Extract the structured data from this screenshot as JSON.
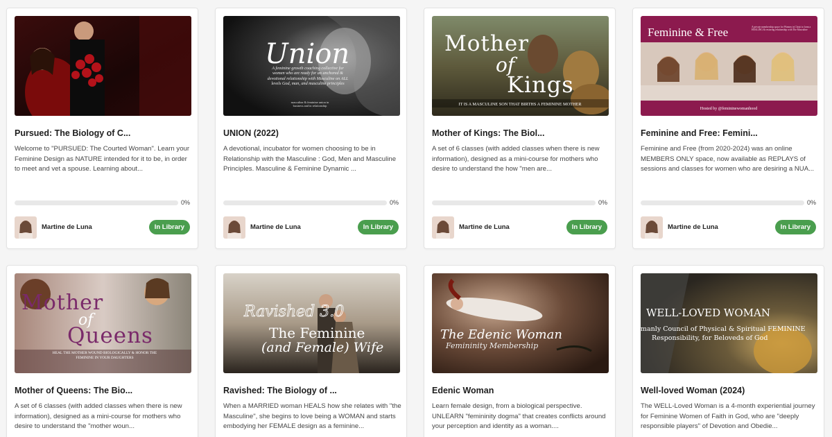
{
  "colors": {
    "accent_green": "#4a9e4e",
    "progress_track": "#e8e8e8"
  },
  "courses": [
    {
      "title": "Pursued: The Biology of C...",
      "description": "Welcome to \"PURSUED: The Courted Woman\". Learn your Feminine Design as NATURE intended for it to be, in order to meet and vet a spouse. Learning about...",
      "progress_percent": 0,
      "progress_label": "0%",
      "author": "Martine de Luna",
      "library_label": "In Library",
      "image": {
        "icon": "couple-roses-photo",
        "overlay_title": "",
        "overlay_subtitle": ""
      }
    },
    {
      "title": "UNION (2022)",
      "description": "A devotional, incubator for women choosing to be in Relationship with the Masculine : God, Men and Masculine Principles. Masculine & Feminine Dynamic ...",
      "progress_percent": 0,
      "progress_label": "0%",
      "author": "Martine de Luna",
      "library_label": "In Library",
      "image": {
        "icon": "embrace-photo",
        "overlay_title": "Union",
        "overlay_subtitle": "A feminine growth coaching collective for women who are ready for an anchored & devotional relationship with Masculine on ALL levels God, man, and masculine principles",
        "overlay_footer": "masculine & feminine union in business and in relationship"
      }
    },
    {
      "title": "Mother of Kings: The Biol...",
      "description": "A set of 6 classes (with added classes when there is new information), designed as a mini-course for mothers who desire to understand the how \"men are...",
      "progress_percent": 0,
      "progress_label": "0%",
      "author": "Martine de Luna",
      "library_label": "In Library",
      "image": {
        "icon": "mother-child-lions-photo",
        "overlay_title": "Mother",
        "overlay_script": "of",
        "overlay_title2": "Kings",
        "overlay_footer": "IT IS A MASCULINE SON THAT BIRTHS A FEMININE MOTHER"
      }
    },
    {
      "title": "Feminine and Free: Femini...",
      "description": "Feminine and Free (from 2020-2024) was an online MEMBERS ONLY space, now available as REPLAYS of sessions and classes for women who are desiring a NUA...",
      "progress_percent": 0,
      "progress_label": "0%",
      "author": "Martine de Luna",
      "library_label": "In Library",
      "image": {
        "icon": "women-group-photo",
        "overlay_title": "Feminine & Free",
        "overlay_subtitle": "A private membership space for Women in Christ to form a HEALING & restoring relationship with The Masculine",
        "overlay_footer": "Hosted by @femininewomanhood"
      }
    },
    {
      "title": "Mother of Queens: The Bio...",
      "description": "A set of 6 classes (with added classes when there is new information), designed as a mini-course for mothers who desire to understand the \"mother woun...",
      "image": {
        "icon": "mothers-daughters-photo",
        "overlay_title": "Mother",
        "overlay_script": "of",
        "overlay_title2": "Queens",
        "overlay_footer": "HEAL THE MOTHER WOUND BIOLOGICALLY & HONOR THE FEMININE IN YOUR DAUGHTERS"
      }
    },
    {
      "title": "Ravished: The Biology of ...",
      "description": "When a MARRIED woman HEALS how she relates with \"the Masculine\", she begins to love being a WOMAN and starts embodying her FEMALE design as a feminine...",
      "image": {
        "icon": "couple-sunset-photo",
        "overlay_script": "Ravished 3.0",
        "overlay_title": "The Feminine",
        "overlay_title2": "(and Female) Wife"
      }
    },
    {
      "title": "Edenic Woman",
      "description": "Learn female design, from a biological perspective. UNLEARN \"femininity dogma\" that creates conflicts around your perception and identity as a woman....",
      "image": {
        "icon": "reclining-woman-photo",
        "overlay_script": "The Edenic Woman",
        "overlay_title": "Femininity Membership"
      }
    },
    {
      "title": "Well-loved Woman (2024)",
      "description": "The WELL-Loved Woman is a 4-month experiential journey for Feminine Women of Faith in God, who are \"deeply responsible players\" of Devotion and Obedie...",
      "image": {
        "icon": "gold-vessel-photo",
        "overlay_title": "WELL-LOVED WOMAN",
        "overlay_subtitle": "manly Council of Physical & Spiritual FEMININE",
        "overlay_subtitle2": "Responsibility, for Beloveds of God"
      }
    }
  ]
}
